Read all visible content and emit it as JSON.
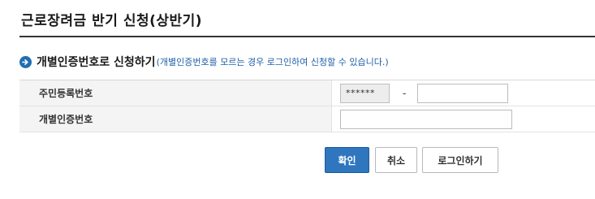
{
  "page": {
    "title": "근로장려금 반기 신청(상반기)"
  },
  "section": {
    "heading": "개별인증번호로 신청하기",
    "note": "(개별인증번호를 모르는 경우 로그인하여 신청할 수 있습니다.)",
    "icon": "arrow-right-circle-icon",
    "icon_color": "#1f6fb2"
  },
  "form": {
    "rrn_label": "주민등록번호",
    "rrn_front_value": "******",
    "rrn_separator": "-",
    "rrn_back_value": "",
    "code_label": "개별인증번호",
    "code_value": ""
  },
  "buttons": {
    "confirm": "확인",
    "cancel": "취소",
    "login": "로그인하기",
    "confirm_color": "#2f76bf"
  }
}
